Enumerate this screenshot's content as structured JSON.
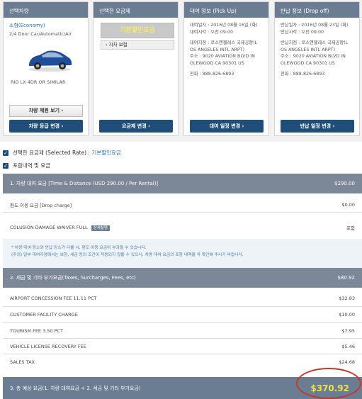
{
  "cards": {
    "car": {
      "header": "선택차량",
      "type": "소형(Economy)",
      "desc": "2/4 Door Car/Automatic/Air",
      "similar": "RIO LX 4DR OR SIMILAR",
      "spec_button": "차량 제원 보기",
      "change_button": "차량 등급 변경"
    },
    "rate": {
      "header": "선택한 요금제",
      "plan": "기본할인요금",
      "insurance": "자차 보험",
      "change_button": "요금제 변경"
    },
    "pickup": {
      "header": "대여 정보 (Pick Up)",
      "date": "대여일자 : 2016년 08월 16일 (화)",
      "time": "대여시각 : 오전 09:00",
      "place1": "대여지점 : 로스앤젤레스 국제공항(L",
      "place2": "OS ANGELES INTL ARPT)",
      "addr1": "주소 : 9020 AVIATION BLVD IN",
      "addr2": "GLEWOOD CA 90301 US",
      "phone": "전화 : 888-826-6893",
      "change_button": "대여 일정 변경"
    },
    "dropoff": {
      "header": "반납 정보 (Drop off)",
      "date": "반납일자 : 2016년 08월 23일 (화)",
      "time": "반납시각 : 오전 09:00",
      "place1": "반납지점 : 로스앤젤레스 국제공항(L",
      "place2": "OS ANGELES INTL ARPT)",
      "addr1": "주소 : 9020 AVIATION BLVD IN",
      "addr2": "GLEWOOD CA 90301 US",
      "phone": "전화 : 888-826-6893",
      "change_button": "반납 일정 변경"
    }
  },
  "selected_rate": {
    "label": "선택한 요금제 (Selected Rate) :",
    "value": "기본할인요금"
  },
  "includes_label": "포함내역 및 요금",
  "section1": {
    "title": "1. 차량 대여 요금 [Time & Distance (USD 290.00 / Per Rental)]",
    "amount": "$290.00",
    "rows": [
      {
        "label": "편도 이용 요금 [Drop charge]",
        "value": "$0.00"
      },
      {
        "label": "COLUSION DAMAGE WAIVER FULL",
        "tag": "상세설명",
        "value": "포함"
      }
    ]
  },
  "note": {
    "line1": "* 차량 대여 장소와 반납 장소가 다를 시, 편도 이용 요금이 부과될 수 있습니다.",
    "line2": "(주의) 일부 대여지점에서는 보험, 세금 등의 조건이 적용되지 않을 수 있으니, 차량 대여 요금의 포함 내역을 꼭 확인해 주시기 바랍니다."
  },
  "section2": {
    "title": "2. 세금 및 기타 부가요금(Taxes, Surcharges, Fees, etc)",
    "amount": "$80.92",
    "rows": [
      {
        "label": "AIRPORT CONCESSION FEE 11.11 PCT",
        "value": "$32.83"
      },
      {
        "label": "CUSTOMER FACILITY CHARGE",
        "value": "$10.00"
      },
      {
        "label": "TOURISM FEE 3.50 PCT",
        "value": "$7.95"
      },
      {
        "label": "VEHICLE LICENSE RECOVERY FEE",
        "value": "$5.46"
      },
      {
        "label": "SALES TAX",
        "value": "$24.68"
      }
    ]
  },
  "total": {
    "title": "3. 총 예상 요금(1. 차량 대여요금 + 2. 세금 및 기타 부가요금)",
    "amount": "$370.92"
  },
  "colors": {
    "header_gray": "#6b7d92",
    "button_navy": "#1f4e79",
    "link_blue": "#2a6fb3",
    "total_yellow": "#f2e04b",
    "highlight_red": "#c0392b"
  }
}
